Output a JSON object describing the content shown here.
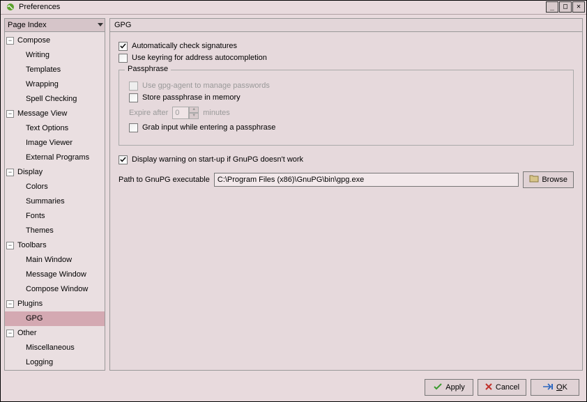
{
  "window": {
    "title": "Preferences"
  },
  "sidebar": {
    "header": "Page Index",
    "groups": [
      {
        "label": "Compose",
        "items": [
          "Writing",
          "Templates",
          "Wrapping",
          "Spell Checking"
        ]
      },
      {
        "label": "Message View",
        "items": [
          "Text Options",
          "Image Viewer",
          "External Programs"
        ]
      },
      {
        "label": "Display",
        "items": [
          "Colors",
          "Summaries",
          "Fonts",
          "Themes"
        ]
      },
      {
        "label": "Toolbars",
        "items": [
          "Main Window",
          "Message Window",
          "Compose Window"
        ]
      },
      {
        "label": "Plugins",
        "items": [
          "GPG"
        ]
      },
      {
        "label": "Other",
        "items": [
          "Miscellaneous",
          "Logging"
        ]
      }
    ],
    "selected": "GPG"
  },
  "panel": {
    "title": "GPG",
    "check_sigs": "Automatically check signatures",
    "check_sigs_checked": true,
    "use_keyring": "Use keyring for address autocompletion",
    "use_keyring_checked": false,
    "passphrase_legend": "Passphrase",
    "use_agent": "Use gpg-agent to manage passwords",
    "use_agent_checked": false,
    "store_mem": "Store passphrase in memory",
    "store_mem_checked": false,
    "expire_label": "Expire after",
    "expire_value": "0",
    "expire_unit": "minutes",
    "grab_input": "Grab input while entering a passphrase",
    "grab_input_checked": false,
    "warn_on_start": "Display warning on start-up if GnuPG doesn't work",
    "warn_on_start_checked": true,
    "path_label": "Path to GnuPG executable",
    "path_value": "C:\\Program Files (x86)\\GnuPG\\bin\\gpg.exe",
    "browse_label": "Browse"
  },
  "buttons": {
    "apply": "Apply",
    "cancel": "Cancel",
    "ok": "OK"
  }
}
